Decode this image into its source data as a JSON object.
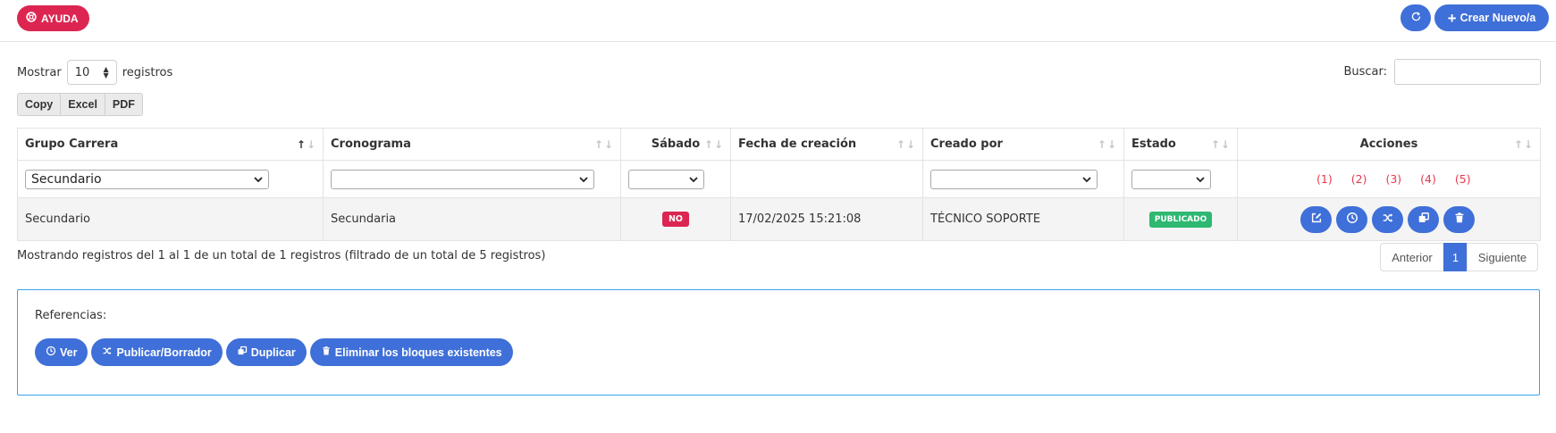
{
  "header": {
    "help_label": "AYUDA",
    "create_label": "Crear Nuevo/a"
  },
  "toolbar": {
    "show_label": "Mostrar",
    "page_length": "10",
    "records_label": "registros",
    "search_label": "Buscar:",
    "search_value": "",
    "export": [
      "Copy",
      "Excel",
      "PDF"
    ]
  },
  "table": {
    "columns": [
      "Grupo Carrera",
      "Cronograma",
      "Sábado",
      "Fecha de creación",
      "Creado por",
      "Estado",
      "Acciones"
    ],
    "filters": {
      "grupo_carrera": "Secundario",
      "cronograma": "",
      "sabado": "",
      "creado_por": "",
      "estado": ""
    },
    "action_refs": [
      "(1)",
      "(2)",
      "(3)",
      "(4)",
      "(5)"
    ],
    "rows": [
      {
        "grupo_carrera": "Secundario",
        "cronograma": "Secundaria",
        "sabado": "NO",
        "fecha": "17/02/2025 15:21:08",
        "creado_por": "TÉCNICO SOPORTE",
        "estado": "PUBLICADO"
      }
    ]
  },
  "footer": {
    "info": "Mostrando registros del 1 al 1 de un total de 1 registros (filtrado de un total de 5 registros)",
    "prev_label": "Anterior",
    "current_page": "1",
    "next_label": "Siguiente"
  },
  "references": {
    "title": "Referencias:",
    "buttons": [
      "Ver",
      "Publicar/Borrador",
      "Duplicar",
      "Eliminar los bloques existentes"
    ]
  },
  "colors": {
    "primary": "#3f6fd8",
    "danger": "#dc2651",
    "success": "#2eb872",
    "reference_number": "#e8384f",
    "panel_border": "#38a4e8"
  }
}
